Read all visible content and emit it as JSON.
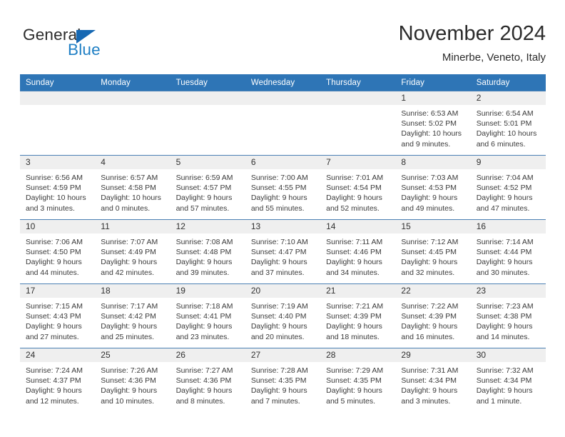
{
  "brand": {
    "name_part1": "General",
    "name_part2": "Blue",
    "triangle_color": "#1668b3",
    "blue_color": "#1f7fc4"
  },
  "header": {
    "title": "November 2024",
    "location": "Minerbe, Veneto, Italy"
  },
  "theme": {
    "header_blue": "#2e75b6",
    "daynum_band": "#efefef",
    "cell_border": "#4a80b4"
  },
  "weekdays": [
    "Sunday",
    "Monday",
    "Tuesday",
    "Wednesday",
    "Thursday",
    "Friday",
    "Saturday"
  ],
  "weeks": [
    [
      {
        "empty": true
      },
      {
        "empty": true
      },
      {
        "empty": true
      },
      {
        "empty": true
      },
      {
        "empty": true
      },
      {
        "day": "1",
        "sunrise": "Sunrise: 6:53 AM",
        "sunset": "Sunset: 5:02 PM",
        "daylight1": "Daylight: 10 hours",
        "daylight2": "and 9 minutes."
      },
      {
        "day": "2",
        "sunrise": "Sunrise: 6:54 AM",
        "sunset": "Sunset: 5:01 PM",
        "daylight1": "Daylight: 10 hours",
        "daylight2": "and 6 minutes."
      }
    ],
    [
      {
        "day": "3",
        "sunrise": "Sunrise: 6:56 AM",
        "sunset": "Sunset: 4:59 PM",
        "daylight1": "Daylight: 10 hours",
        "daylight2": "and 3 minutes."
      },
      {
        "day": "4",
        "sunrise": "Sunrise: 6:57 AM",
        "sunset": "Sunset: 4:58 PM",
        "daylight1": "Daylight: 10 hours",
        "daylight2": "and 0 minutes."
      },
      {
        "day": "5",
        "sunrise": "Sunrise: 6:59 AM",
        "sunset": "Sunset: 4:57 PM",
        "daylight1": "Daylight: 9 hours",
        "daylight2": "and 57 minutes."
      },
      {
        "day": "6",
        "sunrise": "Sunrise: 7:00 AM",
        "sunset": "Sunset: 4:55 PM",
        "daylight1": "Daylight: 9 hours",
        "daylight2": "and 55 minutes."
      },
      {
        "day": "7",
        "sunrise": "Sunrise: 7:01 AM",
        "sunset": "Sunset: 4:54 PM",
        "daylight1": "Daylight: 9 hours",
        "daylight2": "and 52 minutes."
      },
      {
        "day": "8",
        "sunrise": "Sunrise: 7:03 AM",
        "sunset": "Sunset: 4:53 PM",
        "daylight1": "Daylight: 9 hours",
        "daylight2": "and 49 minutes."
      },
      {
        "day": "9",
        "sunrise": "Sunrise: 7:04 AM",
        "sunset": "Sunset: 4:52 PM",
        "daylight1": "Daylight: 9 hours",
        "daylight2": "and 47 minutes."
      }
    ],
    [
      {
        "day": "10",
        "sunrise": "Sunrise: 7:06 AM",
        "sunset": "Sunset: 4:50 PM",
        "daylight1": "Daylight: 9 hours",
        "daylight2": "and 44 minutes."
      },
      {
        "day": "11",
        "sunrise": "Sunrise: 7:07 AM",
        "sunset": "Sunset: 4:49 PM",
        "daylight1": "Daylight: 9 hours",
        "daylight2": "and 42 minutes."
      },
      {
        "day": "12",
        "sunrise": "Sunrise: 7:08 AM",
        "sunset": "Sunset: 4:48 PM",
        "daylight1": "Daylight: 9 hours",
        "daylight2": "and 39 minutes."
      },
      {
        "day": "13",
        "sunrise": "Sunrise: 7:10 AM",
        "sunset": "Sunset: 4:47 PM",
        "daylight1": "Daylight: 9 hours",
        "daylight2": "and 37 minutes."
      },
      {
        "day": "14",
        "sunrise": "Sunrise: 7:11 AM",
        "sunset": "Sunset: 4:46 PM",
        "daylight1": "Daylight: 9 hours",
        "daylight2": "and 34 minutes."
      },
      {
        "day": "15",
        "sunrise": "Sunrise: 7:12 AM",
        "sunset": "Sunset: 4:45 PM",
        "daylight1": "Daylight: 9 hours",
        "daylight2": "and 32 minutes."
      },
      {
        "day": "16",
        "sunrise": "Sunrise: 7:14 AM",
        "sunset": "Sunset: 4:44 PM",
        "daylight1": "Daylight: 9 hours",
        "daylight2": "and 30 minutes."
      }
    ],
    [
      {
        "day": "17",
        "sunrise": "Sunrise: 7:15 AM",
        "sunset": "Sunset: 4:43 PM",
        "daylight1": "Daylight: 9 hours",
        "daylight2": "and 27 minutes."
      },
      {
        "day": "18",
        "sunrise": "Sunrise: 7:17 AM",
        "sunset": "Sunset: 4:42 PM",
        "daylight1": "Daylight: 9 hours",
        "daylight2": "and 25 minutes."
      },
      {
        "day": "19",
        "sunrise": "Sunrise: 7:18 AM",
        "sunset": "Sunset: 4:41 PM",
        "daylight1": "Daylight: 9 hours",
        "daylight2": "and 23 minutes."
      },
      {
        "day": "20",
        "sunrise": "Sunrise: 7:19 AM",
        "sunset": "Sunset: 4:40 PM",
        "daylight1": "Daylight: 9 hours",
        "daylight2": "and 20 minutes."
      },
      {
        "day": "21",
        "sunrise": "Sunrise: 7:21 AM",
        "sunset": "Sunset: 4:39 PM",
        "daylight1": "Daylight: 9 hours",
        "daylight2": "and 18 minutes."
      },
      {
        "day": "22",
        "sunrise": "Sunrise: 7:22 AM",
        "sunset": "Sunset: 4:39 PM",
        "daylight1": "Daylight: 9 hours",
        "daylight2": "and 16 minutes."
      },
      {
        "day": "23",
        "sunrise": "Sunrise: 7:23 AM",
        "sunset": "Sunset: 4:38 PM",
        "daylight1": "Daylight: 9 hours",
        "daylight2": "and 14 minutes."
      }
    ],
    [
      {
        "day": "24",
        "sunrise": "Sunrise: 7:24 AM",
        "sunset": "Sunset: 4:37 PM",
        "daylight1": "Daylight: 9 hours",
        "daylight2": "and 12 minutes."
      },
      {
        "day": "25",
        "sunrise": "Sunrise: 7:26 AM",
        "sunset": "Sunset: 4:36 PM",
        "daylight1": "Daylight: 9 hours",
        "daylight2": "and 10 minutes."
      },
      {
        "day": "26",
        "sunrise": "Sunrise: 7:27 AM",
        "sunset": "Sunset: 4:36 PM",
        "daylight1": "Daylight: 9 hours",
        "daylight2": "and 8 minutes."
      },
      {
        "day": "27",
        "sunrise": "Sunrise: 7:28 AM",
        "sunset": "Sunset: 4:35 PM",
        "daylight1": "Daylight: 9 hours",
        "daylight2": "and 7 minutes."
      },
      {
        "day": "28",
        "sunrise": "Sunrise: 7:29 AM",
        "sunset": "Sunset: 4:35 PM",
        "daylight1": "Daylight: 9 hours",
        "daylight2": "and 5 minutes."
      },
      {
        "day": "29",
        "sunrise": "Sunrise: 7:31 AM",
        "sunset": "Sunset: 4:34 PM",
        "daylight1": "Daylight: 9 hours",
        "daylight2": "and 3 minutes."
      },
      {
        "day": "30",
        "sunrise": "Sunrise: 7:32 AM",
        "sunset": "Sunset: 4:34 PM",
        "daylight1": "Daylight: 9 hours",
        "daylight2": "and 1 minute."
      }
    ]
  ]
}
